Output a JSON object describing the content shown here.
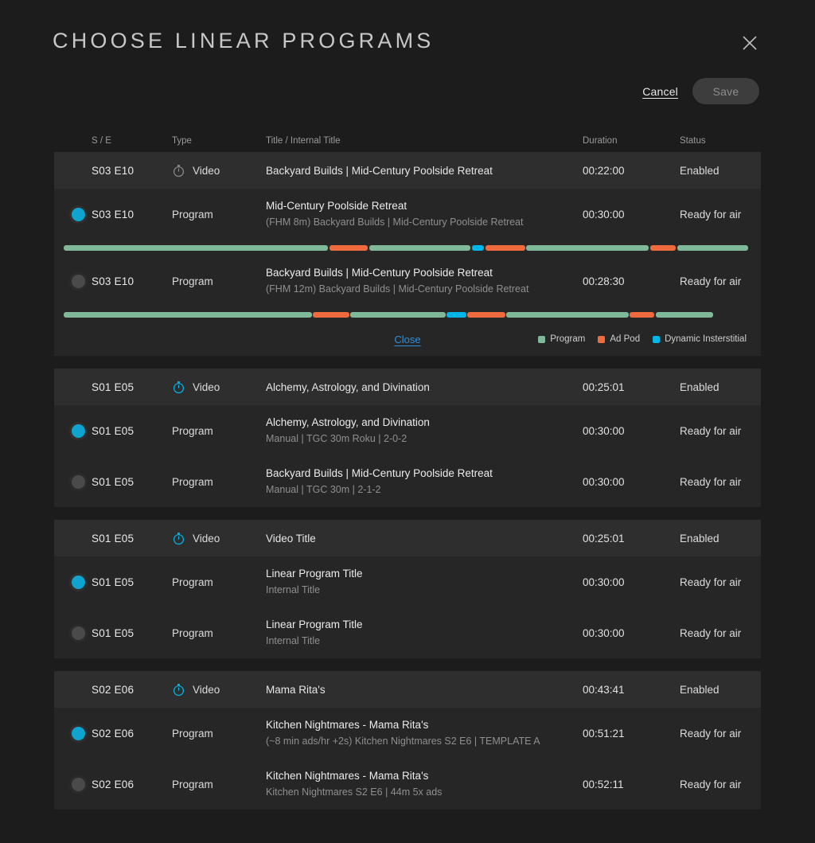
{
  "header": {
    "title": "CHOOSE LINEAR PROGRAMS",
    "close_icon": "close-icon"
  },
  "actions": {
    "cancel_label": "Cancel",
    "save_label": "Save"
  },
  "columns": {
    "se": "S / E",
    "type": "Type",
    "title": "Title / Internal Title",
    "duration": "Duration",
    "status": "Status"
  },
  "legend": {
    "program": "Program",
    "ad_pod": "Ad Pod",
    "interstitial": "Dynamic Insterstitial",
    "close_label": "Close",
    "colors": {
      "program": "#80b89a",
      "ad_pod": "#ef6a3c",
      "interstitial": "#00b5e8"
    }
  },
  "theme": {
    "page_bg": "#1c1c1c",
    "group_bg": "#262626",
    "video_row_bg": "#2e2e2e",
    "accent": "#0fa3d0",
    "link": "#2f8fd8"
  },
  "groups": [
    {
      "video": {
        "se": "S03 E10",
        "icon": "timer-icon",
        "icon_color": "#8a8a8a",
        "type": "Video",
        "title": "Backyard Builds | Mid-Century Poolside Retreat",
        "duration": "00:22:00",
        "status": "Enabled"
      },
      "expanded": true,
      "programs": [
        {
          "selected": true,
          "se": "S03 E10",
          "type": "Program",
          "title": "Mid-Century Poolside Retreat",
          "subtitle": "(FHM 8m) Backyard Builds | Mid-Century Poolside Retreat",
          "duration": "00:30:00",
          "status": "Ready for air",
          "timeline": {
            "width_pct": 100,
            "segments": [
              {
                "kind": "program",
                "start": 0.0,
                "end": 38.6
              },
              {
                "kind": "ad_pod",
                "start": 38.8,
                "end": 44.4
              },
              {
                "kind": "program",
                "start": 44.6,
                "end": 59.4
              },
              {
                "kind": "interstitial",
                "start": 59.6,
                "end": 61.4
              },
              {
                "kind": "ad_pod",
                "start": 61.6,
                "end": 67.4
              },
              {
                "kind": "program",
                "start": 67.6,
                "end": 85.5
              },
              {
                "kind": "ad_pod",
                "start": 85.7,
                "end": 89.4
              },
              {
                "kind": "program",
                "start": 89.6,
                "end": 100.0
              }
            ]
          }
        },
        {
          "selected": false,
          "se": "S03 E10",
          "type": "Program",
          "title": "Backyard Builds | Mid-Century Poolside Retreat",
          "subtitle": "(FHM 12m) Backyard Builds | Mid-Century Poolside Retreat",
          "duration": "00:28:30",
          "status": "Ready for air",
          "timeline": {
            "width_pct": 95,
            "segments": [
              {
                "kind": "program",
                "start": 0.0,
                "end": 38.2
              },
              {
                "kind": "ad_pod",
                "start": 38.4,
                "end": 44.0
              },
              {
                "kind": "program",
                "start": 44.2,
                "end": 58.8
              },
              {
                "kind": "interstitial",
                "start": 59.0,
                "end": 62.0
              },
              {
                "kind": "ad_pod",
                "start": 62.2,
                "end": 68.0
              },
              {
                "kind": "program",
                "start": 68.2,
                "end": 87.0
              },
              {
                "kind": "ad_pod",
                "start": 87.2,
                "end": 91.0
              },
              {
                "kind": "program",
                "start": 91.2,
                "end": 100.0
              }
            ]
          }
        }
      ]
    },
    {
      "video": {
        "se": "S01 E05",
        "icon": "timer-icon",
        "icon_color": "#00b5e8",
        "type": "Video",
        "title": "Alchemy, Astrology, and Divination",
        "duration": "00:25:01",
        "status": "Enabled"
      },
      "expanded": false,
      "programs": [
        {
          "selected": true,
          "se": "S01 E05",
          "type": "Program",
          "title": "Alchemy, Astrology, and Divination",
          "subtitle": "Manual | TGC 30m Roku | 2-0-2",
          "duration": "00:30:00",
          "status": "Ready for air"
        },
        {
          "selected": false,
          "se": "S01 E05",
          "type": "Program",
          "title": "Backyard Builds | Mid-Century Poolside Retreat",
          "subtitle": "Manual | TGC 30m | 2-1-2",
          "duration": "00:30:00",
          "status": "Ready for air"
        }
      ]
    },
    {
      "video": {
        "se": "S01 E05",
        "icon": "timer-icon",
        "icon_color": "#00b5e8",
        "type": "Video",
        "title": "Video Title",
        "duration": "00:25:01",
        "status": "Enabled"
      },
      "expanded": false,
      "programs": [
        {
          "selected": true,
          "se": "S01 E05",
          "type": "Program",
          "title": "Linear Program Title",
          "subtitle": "Internal Title",
          "duration": "00:30:00",
          "status": "Ready for air"
        },
        {
          "selected": false,
          "se": "S01 E05",
          "type": "Program",
          "title": "Linear Program Title",
          "subtitle": "Internal Title",
          "duration": "00:30:00",
          "status": "Ready for air"
        }
      ]
    },
    {
      "video": {
        "se": "S02 E06",
        "icon": "timer-icon",
        "icon_color": "#00b5e8",
        "type": "Video",
        "title": "Mama Rita's",
        "duration": "00:43:41",
        "status": "Enabled"
      },
      "expanded": false,
      "programs": [
        {
          "selected": true,
          "se": "S02 E06",
          "type": "Program",
          "title": "Kitchen Nightmares - Mama Rita's",
          "subtitle": "(~8 min ads/hr +2s) Kitchen Nightmares S2 E6 | TEMPLATE A",
          "duration": "00:51:21",
          "status": "Ready for air"
        },
        {
          "selected": false,
          "se": "S02 E06",
          "type": "Program",
          "title": "Kitchen Nightmares - Mama Rita's",
          "subtitle": "Kitchen Nightmares S2 E6 | 44m 5x ads",
          "duration": "00:52:11",
          "status": "Ready for air"
        }
      ]
    }
  ]
}
